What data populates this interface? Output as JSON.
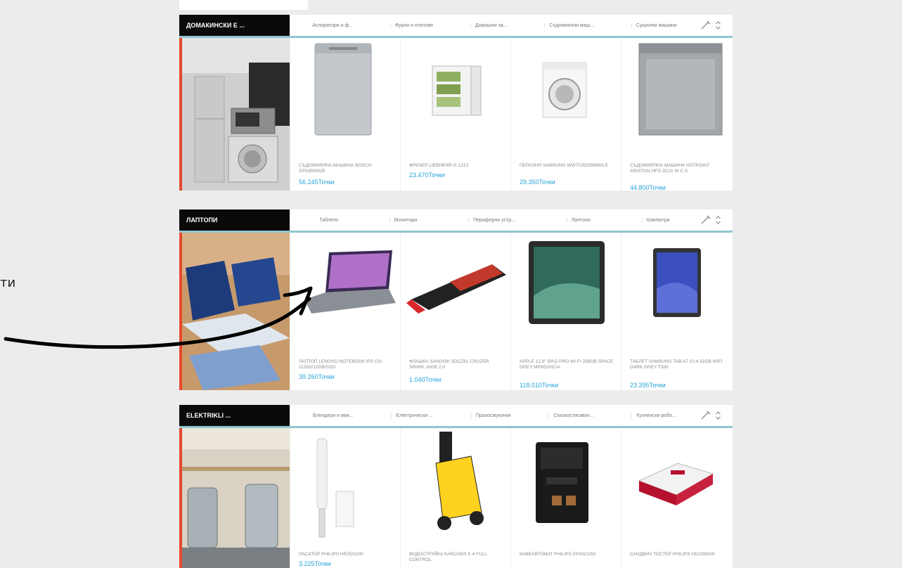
{
  "side_text": "ти",
  "sections": [
    {
      "title": "ДОМАКИНСКИ Е ...",
      "tabs": [
        "Аспиратори и ф...",
        "Фурни и плотове",
        "Домашни за...",
        "Съдомиялни маш...",
        "Сушилни машини"
      ],
      "products": [
        {
          "name": "СЪДОМИЯЛНА МАШИНА BOSCH SPS45W02E",
          "price": "56.245Точки",
          "image": "dishwasher-silver"
        },
        {
          "name": "ФРИЗЕР LIEBHERR G 1213",
          "price": "23.470Точки",
          "image": "freezer-white"
        },
        {
          "name": "ПЕРАЛНЯ SAMSUNG WW70J5255MW/LE",
          "price": "29.350Точки",
          "image": "washing-machine"
        },
        {
          "name": "СЪДОМИЯЛНА МАШИНА HOTPOINT ARISTON HFO 3C21 W C X",
          "price": "44.800Точки",
          "image": "dishwasher-steel"
        }
      ]
    },
    {
      "title": "ЛАПТОПИ",
      "tabs": [
        "Таблети",
        "Монитори",
        "Периферни устр...",
        "Лаптопи",
        "Компютри"
      ],
      "products": [
        {
          "name": "ЛАПТОП LENOVO NOTEBOOK IP3 CI3-1115G/12GB/SSD",
          "price": "39.260Точки",
          "image": "laptop"
        },
        {
          "name": "ФЛАШКА SANDISK SDCZ61 CRUZER SPARK 16GB 2.0",
          "price": "1.040Точки",
          "image": "usb-flash"
        },
        {
          "name": "APPLE 12.9\" IPAD PRO WI-FI 256GB SPACE GREY MP6G2HC/A",
          "price": "118.010Точки",
          "image": "ipad"
        },
        {
          "name": "ТАБЛЕТ SAMSUNG TAB A7 10.4 32GB WIFI DARK GREY T500",
          "price": "23.395Точки",
          "image": "tablet"
        }
      ]
    },
    {
      "title": "ELEKTRIKLI ...",
      "tabs": [
        "Блендери и мик...",
        "Електрически ...",
        "Прахосмукачки",
        "Сокоизстисквач...",
        "Кухненски робо..."
      ],
      "products": [
        {
          "name": "ПАСАТОР PHILIPS HR2531/00",
          "price": "3.225Точки",
          "image": "hand-blender"
        },
        {
          "name": "ВОДОСТРУЙКА KARCHER K 4 FULL CONTROL",
          "price": "",
          "image": "pressure-washer"
        },
        {
          "name": "КАФЕАВТОМАТ PHILIPS EP4321/50",
          "price": "",
          "image": "coffee-machine"
        },
        {
          "name": "САНДВИЧ ТОСТЕР PHILIPS HD2393/00",
          "price": "",
          "image": "sandwich-toaster"
        }
      ]
    }
  ],
  "colors": {
    "accent": "#27a4d8",
    "header_bg": "#0a0a0a",
    "promo_border": "#e8482d",
    "header_underline": "#8fc7cf"
  }
}
